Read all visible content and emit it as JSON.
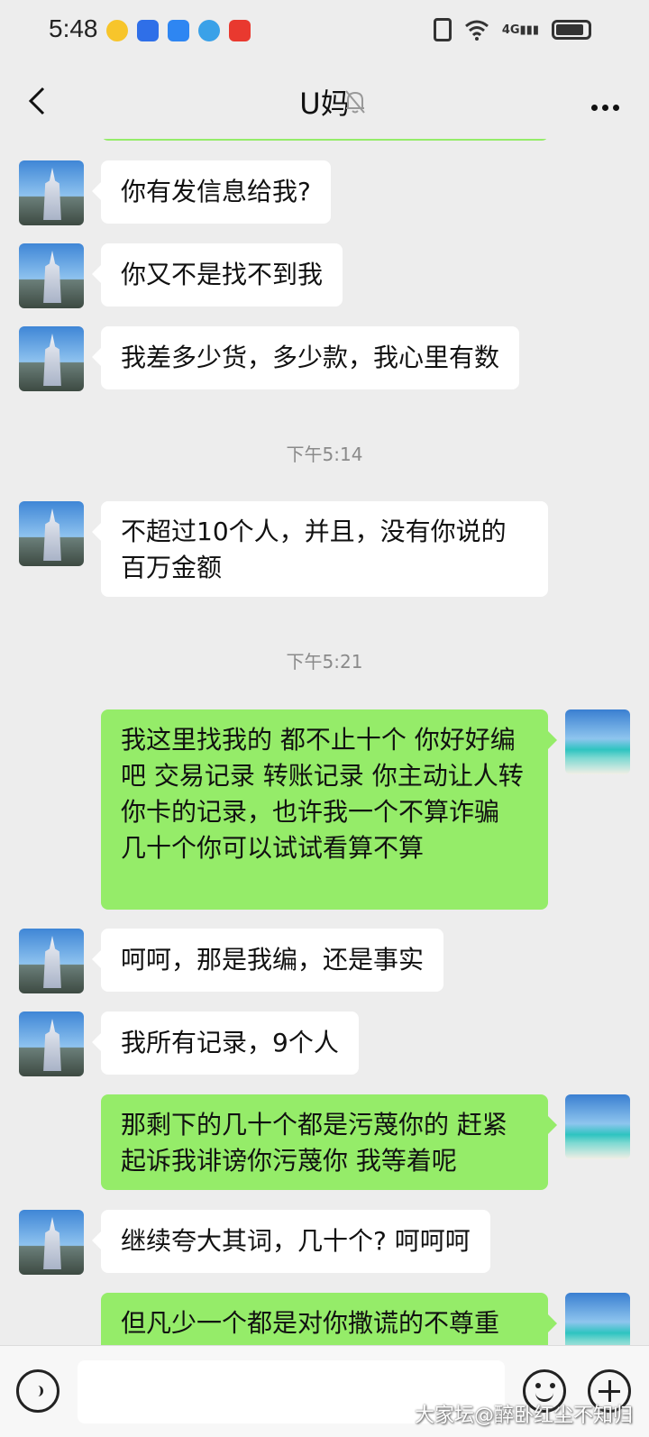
{
  "status_bar": {
    "time": "5:48",
    "network_label": "4G"
  },
  "header": {
    "title": "U妈"
  },
  "messages": [
    {
      "side": "in",
      "avatar": "castle",
      "text": "你有发信息给我?"
    },
    {
      "side": "in",
      "avatar": "castle",
      "text": "你又不是找不到我"
    },
    {
      "side": "in",
      "avatar": "castle",
      "text": "我差多少货，多少款，我心里有数"
    },
    {
      "side": "time",
      "text": "下午5:14"
    },
    {
      "side": "in",
      "avatar": "castle",
      "text": "不超过10个人，并且，没有你说的百万金额"
    },
    {
      "side": "time",
      "text": "下午5:21"
    },
    {
      "side": "out",
      "avatar": "beach",
      "text": "我这里找我的  都不止十个  你好好编吧   交易记录  转账记录  你主动让人转你卡的记录，也许我一个不算诈骗   几十个你可以试试看算不算"
    },
    {
      "side": "in",
      "avatar": "castle",
      "text": "呵呵，那是我编，还是事实"
    },
    {
      "side": "in",
      "avatar": "castle",
      "text": "我所有记录，9个人"
    },
    {
      "side": "out",
      "avatar": "beach",
      "text": "那剩下的几十个都是污蔑你的  赶紧起诉我诽谤你污蔑你   我等着呢"
    },
    {
      "side": "in",
      "avatar": "castle",
      "text": "继续夸大其词，几十个? 呵呵呵"
    },
    {
      "side": "out",
      "avatar": "beach",
      "text": "但凡少一个都是对你撒谎的不尊重"
    }
  ],
  "watermark": "大家坛@醉卧红尘不知归"
}
